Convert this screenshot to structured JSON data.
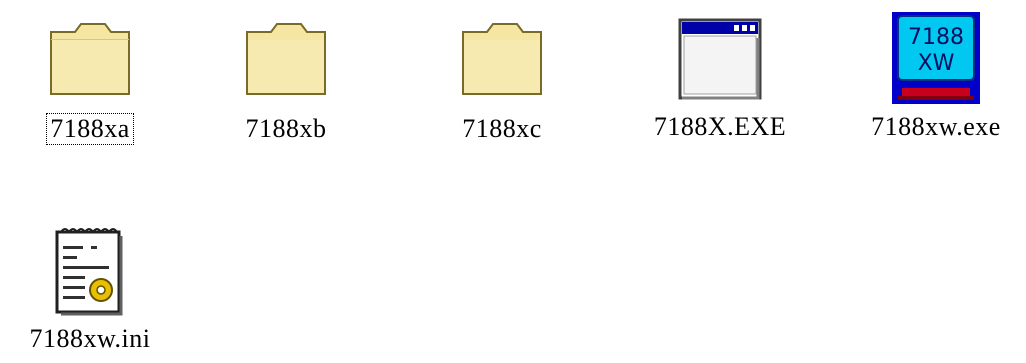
{
  "items": [
    {
      "label": "7188xa",
      "icon": "folder-icon",
      "selected": true
    },
    {
      "label": "7188xb",
      "icon": "folder-icon",
      "selected": false
    },
    {
      "label": "7188xc",
      "icon": "folder-icon",
      "selected": false
    },
    {
      "label": "7188X.EXE",
      "icon": "application-window-icon",
      "selected": false
    },
    {
      "label": "7188xw.exe",
      "icon": "monitor-app-icon",
      "selected": false,
      "icon_text": [
        "7188",
        "XW"
      ]
    },
    {
      "label": "7188xw.ini",
      "icon": "config-file-icon",
      "selected": false
    }
  ],
  "colors": {
    "folder": "#f5e7a3",
    "folder_stroke": "#7a6a28",
    "window_title": "#0000a8",
    "monitor_screen": "#00c8f0",
    "monitor_base": "#c8001e",
    "gear": "#e8c000"
  }
}
